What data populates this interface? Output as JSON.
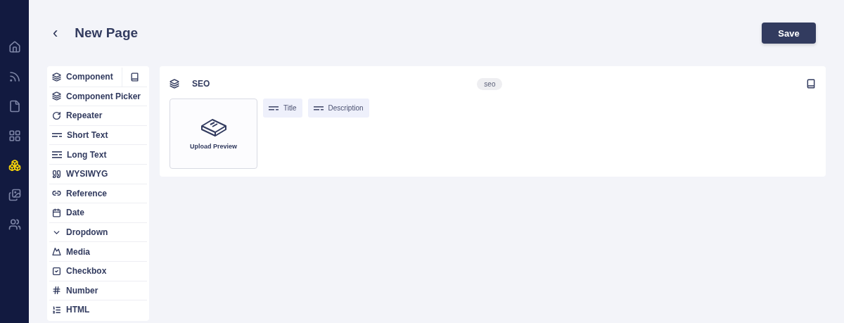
{
  "nav": [
    {
      "kind": "home",
      "selected": false
    },
    {
      "kind": "feed",
      "selected": false
    },
    {
      "kind": "file",
      "selected": false
    },
    {
      "kind": "grid",
      "selected": false
    },
    {
      "kind": "boxes",
      "selected": true
    },
    {
      "kind": "images",
      "selected": false
    },
    {
      "kind": "users",
      "selected": false
    }
  ],
  "header": {
    "back": "‹",
    "title": "New Page",
    "save": "Save"
  },
  "palette": [
    {
      "kind": "component",
      "label": "Component"
    },
    {
      "kind": "component_picker",
      "label": "Component Picker"
    },
    {
      "kind": "repeater",
      "label": "Repeater"
    },
    {
      "kind": "short_text",
      "label": "Short Text"
    },
    {
      "kind": "long_text",
      "label": "Long Text"
    },
    {
      "kind": "wysiwyg",
      "label": "WYSIWYG"
    },
    {
      "kind": "reference",
      "label": "Reference"
    },
    {
      "kind": "date",
      "label": "Date"
    },
    {
      "kind": "dropdown",
      "label": "Dropdown"
    },
    {
      "kind": "media",
      "label": "Media"
    },
    {
      "kind": "checkbox",
      "label": "Checkbox"
    },
    {
      "kind": "number",
      "label": "Number"
    },
    {
      "kind": "html",
      "label": "HTML"
    }
  ],
  "component": {
    "name": "SEO",
    "key": "seo",
    "preview": "Upload Preview",
    "fields": [
      {
        "kind": "short_text",
        "label": "Title"
      },
      {
        "kind": "short_text",
        "label": "Description"
      }
    ]
  }
}
